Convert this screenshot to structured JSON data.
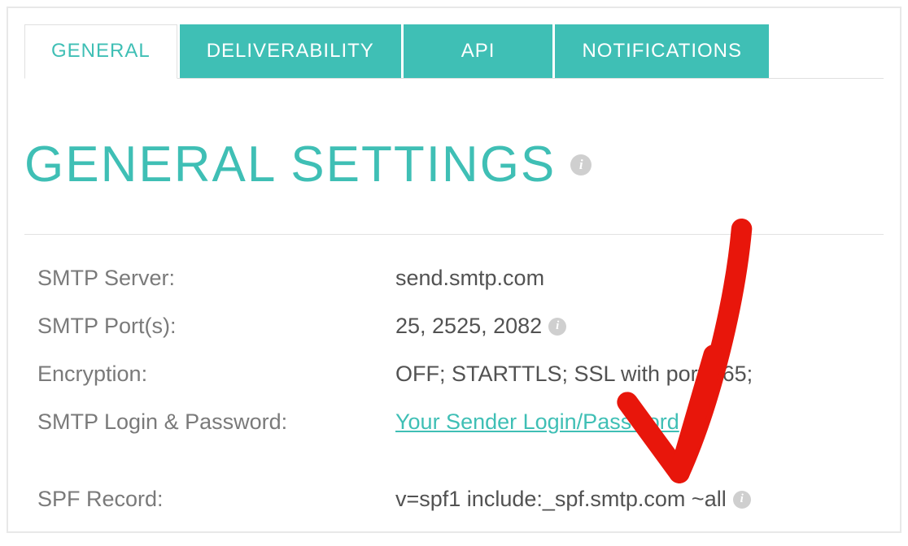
{
  "tabs": {
    "general": "GENERAL",
    "deliverability": "DELIVERABILITY",
    "api": "API",
    "notifications": "NOTIFICATIONS"
  },
  "heading": "GENERAL SETTINGS",
  "settings": {
    "smtp_server": {
      "label": "SMTP Server:",
      "value": "send.smtp.com"
    },
    "smtp_ports": {
      "label": "SMTP Port(s):",
      "value": "25, 2525, 2082"
    },
    "encryption": {
      "label": "Encryption:",
      "value": "OFF; STARTTLS; SSL with port 465;"
    },
    "login_password": {
      "label": "SMTP Login & Password:",
      "link": "Your Sender Login/Password"
    },
    "spf_record": {
      "label": "SPF Record:",
      "value": "v=spf1 include:_spf.smtp.com ~all"
    }
  }
}
